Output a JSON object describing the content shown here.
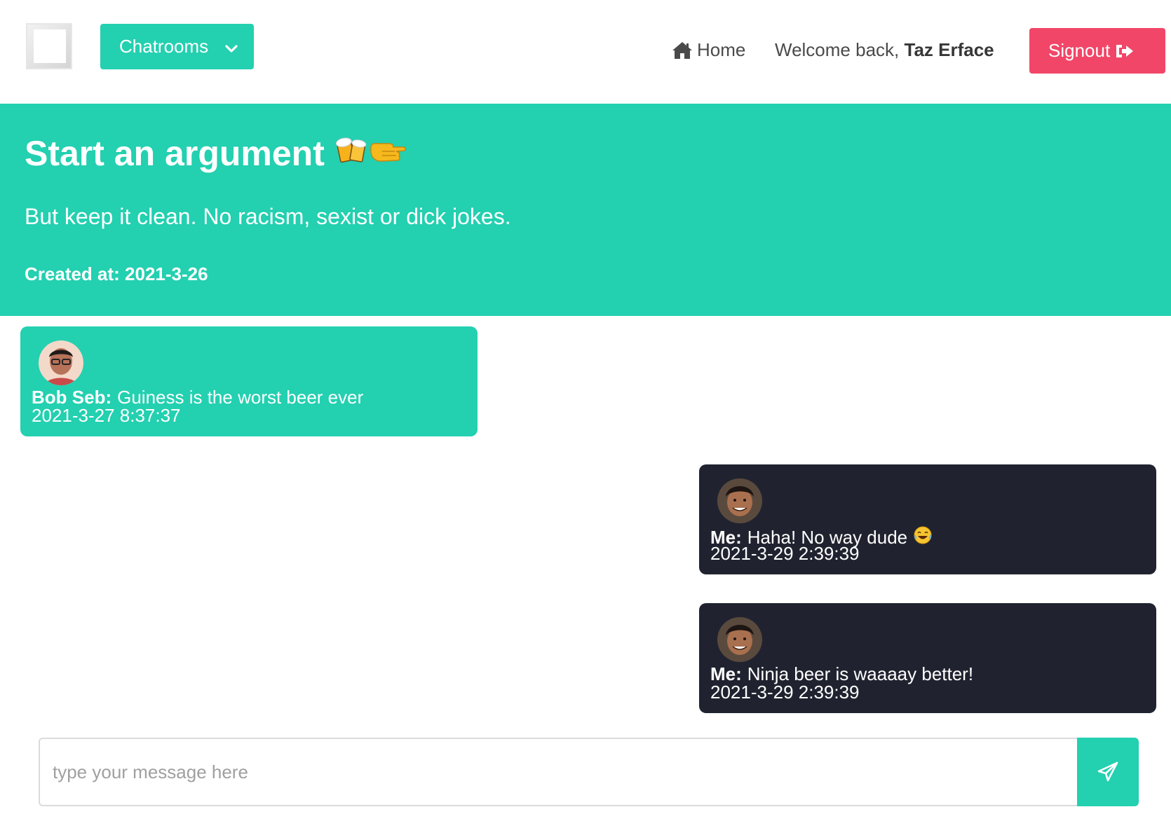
{
  "navbar": {
    "logo_icon": "logo-square-icon",
    "chatrooms_label": "Chatrooms",
    "home_label": "Home",
    "welcome_prefix": "Welcome back,",
    "username": "Taz Erface",
    "signout_label": "Signout"
  },
  "room": {
    "title": "Start an argument",
    "title_emoji": [
      "beer-mugs-emoji",
      "left-fist-emoji"
    ],
    "description": "But keep it clean. No racism, sexist or dick jokes.",
    "created_label": "Created at: 2021-3-26"
  },
  "messages": [
    {
      "author": "Bob Seb:",
      "text": "Guiness is the worst beer ever",
      "time": "2021-3-27 8:37:37",
      "mine": false
    },
    {
      "author": "Me:",
      "text": "Haha! No way dude",
      "emoji": "laughing-tears-emoji",
      "time": "2021-3-29 2:39:39",
      "mine": true
    },
    {
      "author": "Me:",
      "text": "Ninja beer is waaaay better!",
      "time": "2021-3-29 2:39:39",
      "mine": true
    }
  ],
  "composer": {
    "placeholder": "type your message here",
    "send_icon": "paper-plane-icon"
  },
  "colors": {
    "primary": "#23d0b0",
    "danger": "#f14668",
    "dark_bubble": "#20232f"
  }
}
